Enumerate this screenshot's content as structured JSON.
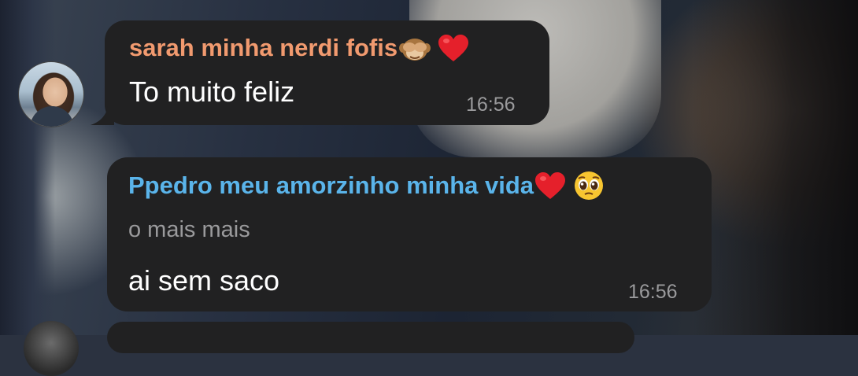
{
  "messages": [
    {
      "sender": "sarah minha nerdi fofis",
      "sender_emojis": [
        "see-no-evil-monkey",
        "red-heart"
      ],
      "sender_color": "#f19a6f",
      "text": "To muito feliz",
      "time": "16:56"
    },
    {
      "sender": "Ppedro meu amorzinho minha vida",
      "sender_emojis": [
        "red-heart",
        "pleading-face"
      ],
      "sender_color": "#5ab4ea",
      "reply_preview": "o mais mais",
      "text": "ai sem saco",
      "time": "16:56"
    }
  ],
  "colors": {
    "bubble": "#212122",
    "time": "#9a9a9c",
    "text": "#ffffff"
  }
}
